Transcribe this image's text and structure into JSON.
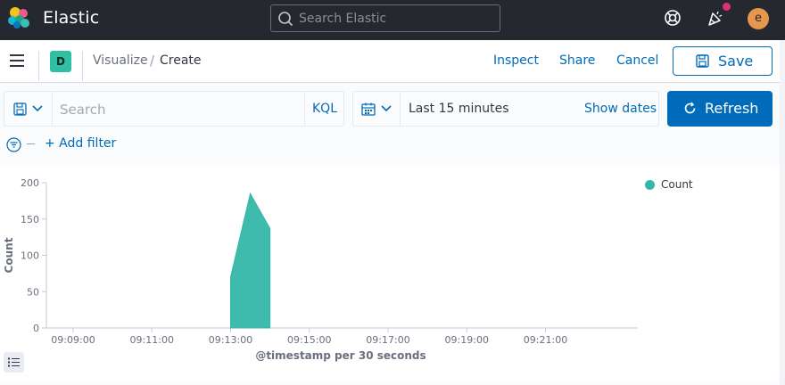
{
  "app": {
    "brand": "Elastic"
  },
  "header": {
    "search_placeholder": "Search Elastic",
    "avatar_initial": "e",
    "icons": [
      "elastic-logo-icon",
      "search-icon",
      "help-icon",
      "newsfeed-icon"
    ]
  },
  "subbar": {
    "space_initial": "D",
    "breadcrumbs": [
      "Visualize",
      "Create"
    ],
    "links": {
      "inspect": "Inspect",
      "share": "Share",
      "cancel": "Cancel"
    },
    "save_label": "Save"
  },
  "query": {
    "placeholder": "Search",
    "language": "KQL",
    "time_range": "Last 15 minutes",
    "show_dates": "Show dates",
    "refresh_label": "Refresh"
  },
  "filters": {
    "add_filter": "+ Add filter"
  },
  "colors": {
    "accent": "#006bb8",
    "series": "#34b7a8",
    "header_bg": "#25282f"
  },
  "chart_data": {
    "type": "area",
    "xlabel": "@timestamp per 30 seconds",
    "ylabel": "Count",
    "ylim": [
      0,
      200
    ],
    "y_ticks": [
      "0",
      "50",
      "100",
      "150",
      "200"
    ],
    "x_ticks": [
      "09:09:00",
      "09:11:00",
      "09:13:00",
      "09:15:00",
      "09:17:00",
      "09:19:00",
      "09:21:00"
    ],
    "legend_position": "top-right",
    "grid": false,
    "series": [
      {
        "name": "Count",
        "x": [
          "09:13:00",
          "09:13:30",
          "09:14:00"
        ],
        "values": [
          70,
          185,
          137
        ]
      }
    ]
  }
}
